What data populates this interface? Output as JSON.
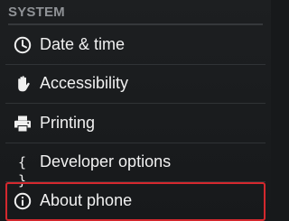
{
  "section": {
    "title": "SYSTEM"
  },
  "items": [
    {
      "label": "Date & time",
      "icon": "clock-icon"
    },
    {
      "label": "Accessibility",
      "icon": "hand-icon"
    },
    {
      "label": "Printing",
      "icon": "printer-icon"
    },
    {
      "label": "Developer options",
      "icon": "braces-icon",
      "icon_text": "{ }"
    },
    {
      "label": "About phone",
      "icon": "info-icon",
      "highlighted": true
    }
  ],
  "colors": {
    "background": "#17191b",
    "header_text": "#8f9296",
    "item_text": "#f1f1f1",
    "highlight_border": "#d4282e"
  }
}
